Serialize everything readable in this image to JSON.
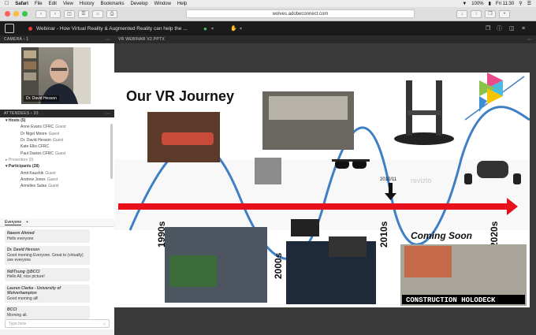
{
  "menubar": {
    "app": "Safari",
    "items": [
      "File",
      "Edit",
      "View",
      "History",
      "Bookmarks",
      "Develop",
      "Window",
      "Help"
    ],
    "battery": "100%",
    "clock": "Fri 11:30"
  },
  "browser": {
    "url": "wolves.adobeconnect.com"
  },
  "app": {
    "title": "Webinar - How Virtual Reality & Augmented Reality can help the ..."
  },
  "camera": {
    "header": "CAMERA › 1",
    "name": "Dr. David Hesson"
  },
  "attendees": {
    "header": "ATTENDEES › 33",
    "hosts_label": "Hosts (5)",
    "hosts": [
      {
        "name": "Anne Evans CFRC",
        "role": "Guest"
      },
      {
        "name": "Dr Nigel Moore",
        "role": "Guest"
      },
      {
        "name": "Dr. David Hesson",
        "role": "Guest"
      },
      {
        "name": "Kate Ellis CFRC",
        "role": ""
      },
      {
        "name": "Paul Davies CFRC",
        "role": "Guest"
      }
    ],
    "presenters_label": "Presenters (0)",
    "participants_label": "Participants (28)",
    "participants": [
      {
        "name": "Amit Kaushik",
        "role": "Guest"
      },
      {
        "name": "Andrew Jones",
        "role": "Guest"
      },
      {
        "name": "Annelies Salas",
        "role": "Guest"
      }
    ]
  },
  "chat": {
    "tab": "Everyone",
    "add": "+",
    "messages": [
      {
        "who": "Naeem Ahmed",
        "text": "Hello everyone"
      },
      {
        "who": "Dr. David Hesson",
        "text": "Good morning Everyone. Great to (virtually) see everyone"
      },
      {
        "who": "NdiTsung @BCCI",
        "text": "Hello All, nice picture!"
      },
      {
        "who": "Lauren Clarke - University of Wolverhampton",
        "text": "Good morning all!"
      },
      {
        "who": "BCCI",
        "text": "Morning all."
      }
    ],
    "placeholder": "Type here"
  },
  "share": {
    "header": "VR WEBINAR V2.PPTX"
  },
  "slide": {
    "title": "Our VR Journey",
    "decades": [
      "1990s",
      "2000s",
      "2010s",
      "2020s"
    ],
    "marker": "2010/11",
    "coming": "Coming Soon",
    "caption": "CONSTRUCTION HOLODECK",
    "watermark": "revizto"
  },
  "colors": {
    "arrow": "#e8101a",
    "wave": "#3f7fc4",
    "appbar": "#1b1b1b"
  }
}
